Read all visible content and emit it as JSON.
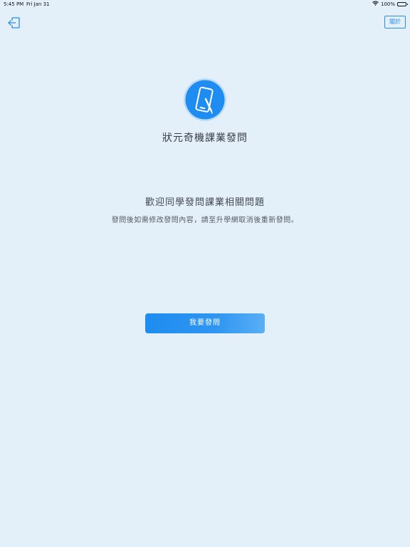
{
  "status_bar": {
    "time": "5:45 PM",
    "date": "Fri Jan 31",
    "battery_text": "100%",
    "battery_level": 1.0,
    "wifi_icon": "wifi-icon"
  },
  "header": {
    "exit_icon": "exit-icon",
    "about_label": "關於"
  },
  "brand": {
    "logo_icon": "tablet-pen-icon",
    "title": "狀元奇機課業發問",
    "accent_color": "#1e8cf0"
  },
  "welcome": {
    "title": "歡迎同學發問課業相關問題",
    "note": "發問後如需修改發問內容，請至升學網取消後重新發問。"
  },
  "actions": {
    "ask_label": "我要發問"
  }
}
